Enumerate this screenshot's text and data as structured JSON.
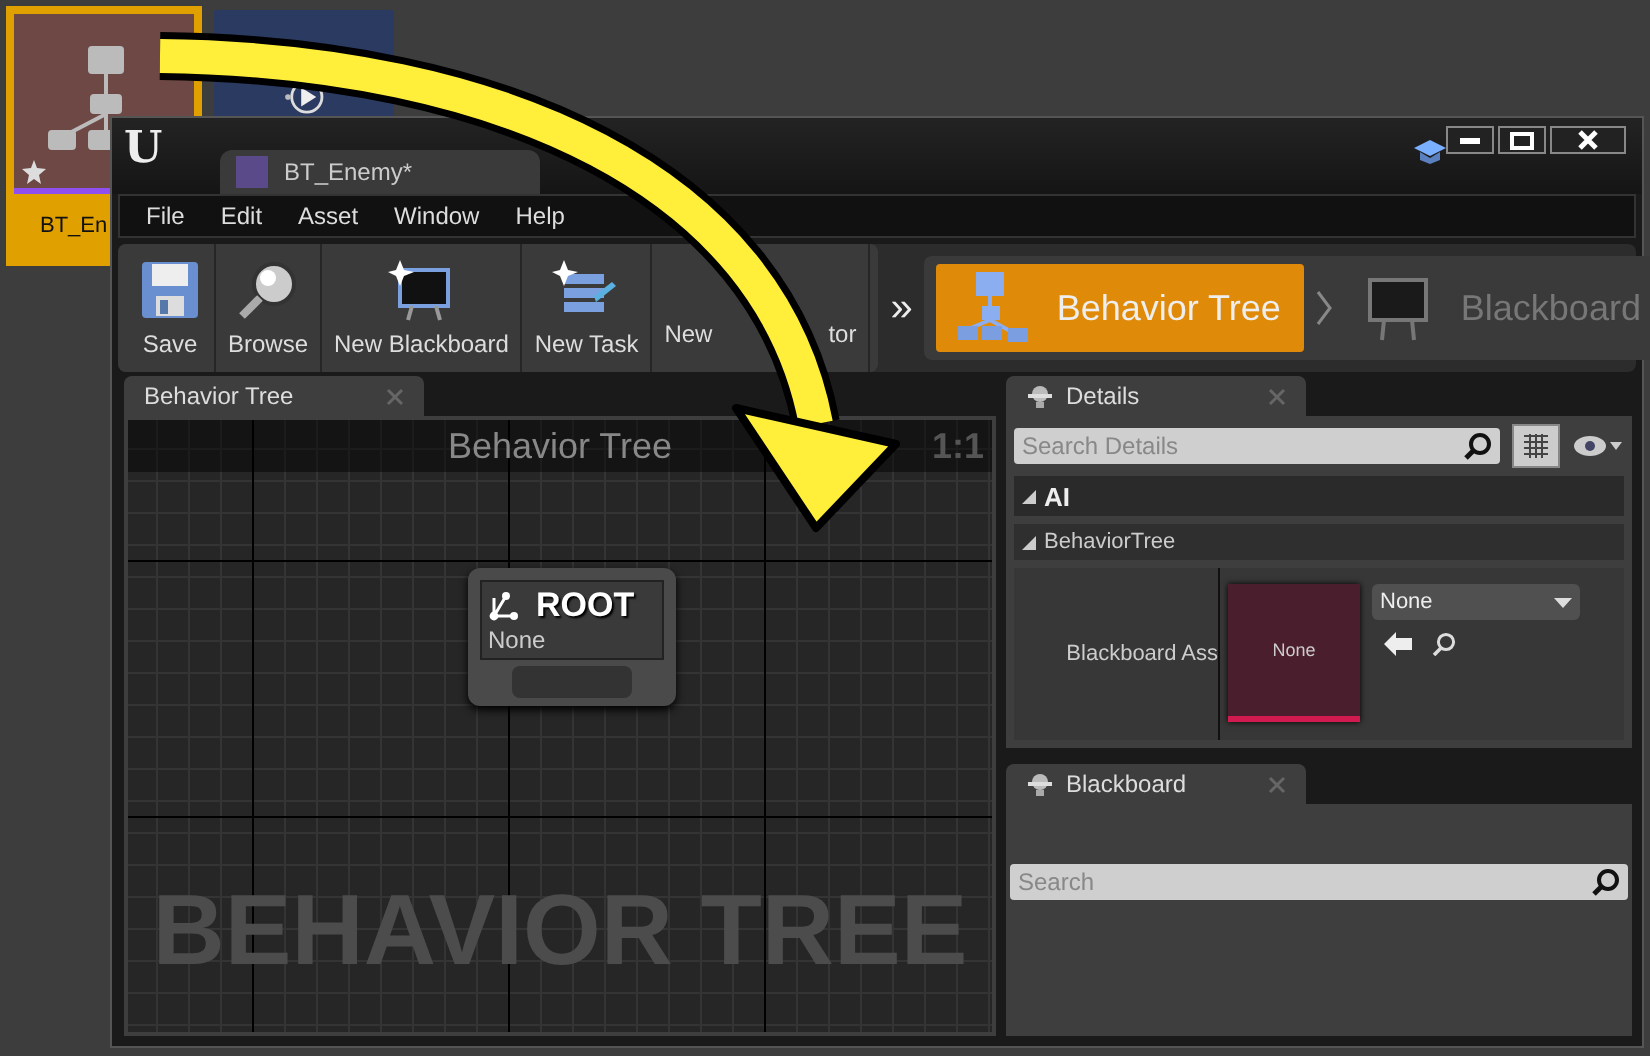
{
  "desktop_assets": [
    {
      "kind": "behavior-tree",
      "label": "BT_En",
      "selected": true
    },
    {
      "kind": "media",
      "selected": false
    }
  ],
  "window": {
    "logo": "U",
    "tab_title": "BT_Enemy*"
  },
  "menu": [
    "File",
    "Edit",
    "Asset",
    "Window",
    "Help"
  ],
  "toolbar": [
    {
      "kind": "save",
      "label": "Save"
    },
    {
      "kind": "browse",
      "label": "Browse"
    },
    {
      "kind": "blackboard",
      "label": "New Blackboard"
    },
    {
      "kind": "task",
      "label": "New Task"
    },
    {
      "kind": "decorator",
      "label": "New",
      "label_tail": "tor"
    }
  ],
  "overflow": "»",
  "modes": [
    {
      "kind": "tree",
      "label": "Behavior Tree",
      "selected": true
    },
    {
      "kind": "blackboard",
      "label": "Blackboard",
      "selected": false
    }
  ],
  "graph_panel": {
    "tab": "Behavior Tree",
    "title": "Behavior Tree",
    "zoom": "1:1",
    "watermark": "BEHAVIOR TREE",
    "node": {
      "title": "ROOT",
      "subtitle": "None"
    }
  },
  "details": {
    "tab": "Details",
    "search": {
      "placeholder": "Search Details"
    },
    "category": "AI",
    "subcategory": "BehaviorTree",
    "property": {
      "label": "Blackboard Ass",
      "thumbnail": "None",
      "value": "None"
    }
  },
  "blackboard": {
    "tab": "Blackboard",
    "search": {
      "placeholder": "Search"
    }
  }
}
